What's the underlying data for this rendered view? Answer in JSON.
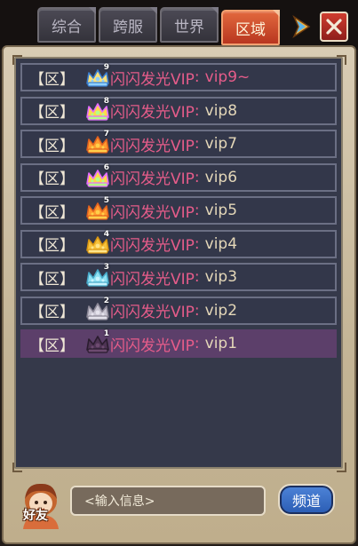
{
  "tabs": [
    {
      "label": "综合",
      "active": false
    },
    {
      "label": "跨服",
      "active": false
    },
    {
      "label": "世界",
      "active": false
    },
    {
      "label": "区域",
      "active": true
    }
  ],
  "colors": {
    "accent_tab": "#d0502f",
    "name_pink": "#e65c8a",
    "vip_text": "#e4d7b8",
    "highlight_row": "#5c3f6a",
    "panel_bg": "#35394a"
  },
  "messages": [
    {
      "tag": "【区】",
      "vip_level": "9",
      "name": "闪闪发光VIP",
      "colon": ":",
      "text": "vip9~",
      "text_pink": true,
      "crown": "crown-blue"
    },
    {
      "tag": "【区】",
      "vip_level": "8",
      "name": "闪闪发光VIP",
      "colon": ":",
      "text": "vip8",
      "text_pink": false,
      "crown": "crown-rainbow"
    },
    {
      "tag": "【区】",
      "vip_level": "7",
      "name": "闪闪发光VIP",
      "colon": ":",
      "text": "vip7",
      "text_pink": false,
      "crown": "crown-orange"
    },
    {
      "tag": "【区】",
      "vip_level": "6",
      "name": "闪闪发光VIP",
      "colon": ":",
      "text": "vip6",
      "text_pink": false,
      "crown": "crown-rainbow"
    },
    {
      "tag": "【区】",
      "vip_level": "5",
      "name": "闪闪发光VIP",
      "colon": ":",
      "text": "vip5",
      "text_pink": false,
      "crown": "crown-orange"
    },
    {
      "tag": "【区】",
      "vip_level": "4",
      "name": "闪闪发光VIP",
      "colon": ":",
      "text": "vip4",
      "text_pink": false,
      "crown": "crown-gold"
    },
    {
      "tag": "【区】",
      "vip_level": "3",
      "name": "闪闪发光VIP",
      "colon": ":",
      "text": "vip3",
      "text_pink": false,
      "crown": "crown-cyan"
    },
    {
      "tag": "【区】",
      "vip_level": "2",
      "name": "闪闪发光VIP",
      "colon": ":",
      "text": "vip2",
      "text_pink": false,
      "crown": "crown-gray"
    },
    {
      "tag": "【区】",
      "vip_level": "1",
      "name": "闪闪发光VIP",
      "colon": ":",
      "text": "vip1",
      "text_pink": false,
      "crown": "crown-dark",
      "highlighted": true
    }
  ],
  "bottom": {
    "friends_label": "好友",
    "input_placeholder": "<输入信息>",
    "channel_label": "频道"
  },
  "icons": {
    "arrow": "arrow-right-icon",
    "close": "close-icon",
    "friends": "friends-avatar-icon"
  }
}
